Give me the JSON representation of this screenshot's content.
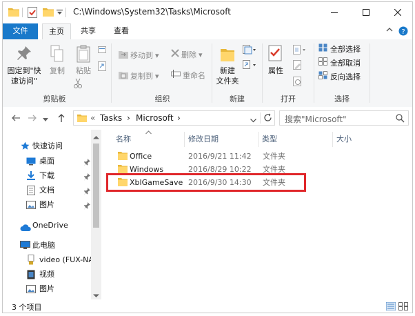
{
  "title_bar": {
    "path": "C:\\Windows\\System32\\Tasks\\Microsoft",
    "quick_access_icons": [
      "folder-icon",
      "properties-check-icon",
      "new-folder-icon",
      "customize-dropdown-icon"
    ],
    "controls": [
      "minimize-icon",
      "maximize-icon",
      "close-icon"
    ]
  },
  "ribbon_tabs": {
    "file": "文件",
    "home": "主页",
    "share": "共享",
    "view": "查看"
  },
  "ribbon": {
    "clipboard": {
      "label": "剪贴板",
      "pin_quick_access": "固定到\"快\n速访问\"",
      "copy": "复制",
      "paste": "粘贴"
    },
    "organize": {
      "label": "组织",
      "move_to": "移动到",
      "copy_to": "复制到",
      "delete": "删除",
      "rename": "重命名"
    },
    "new": {
      "label": "新建",
      "new_folder": "新建\n文件夹"
    },
    "open": {
      "label": "打开",
      "properties": "属性"
    },
    "select": {
      "label": "选择",
      "select_all": "全部选择",
      "select_none": "全部取消",
      "invert": "反向选择"
    }
  },
  "address_bar": {
    "crumb_prefix": "«",
    "crumbs": [
      "Tasks",
      "Microsoft"
    ],
    "search_placeholder": "搜索\"Microsoft\""
  },
  "nav_pane": {
    "quick_access": "快速访问",
    "desktop": "桌面",
    "downloads": "下载",
    "documents": "文档",
    "pictures": "图片",
    "onedrive": "OneDrive",
    "this_pc": "此电脑",
    "video_drive": "video (FUX-NA",
    "videos": "视频",
    "pictures2": "图片"
  },
  "file_list": {
    "columns": {
      "name": "名称",
      "date": "修改日期",
      "type": "类型",
      "size": "大小"
    },
    "rows": [
      {
        "name": "Office",
        "date": "2016/9/21 11:42",
        "type": "文件夹"
      },
      {
        "name": "Windows",
        "date": "2016/8/29 10:22",
        "type": "文件夹"
      },
      {
        "name": "XblGameSave",
        "date": "2016/9/30 14:30",
        "type": "文件夹"
      }
    ]
  },
  "status_bar": {
    "item_count": "3 个项目"
  },
  "colors": {
    "file_tab": "#1979ca",
    "folder": "#ffd66b",
    "highlight_box": "#e0272b",
    "column_header_text": "#4c607a"
  }
}
